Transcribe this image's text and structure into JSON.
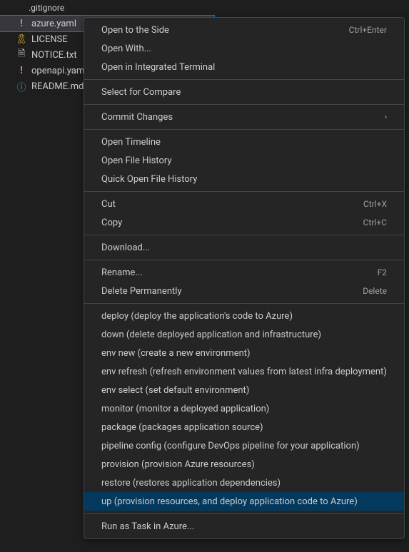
{
  "fileTree": {
    "items": [
      {
        "name": "azure.yaml",
        "icon": "yaml",
        "iconChar": "!",
        "selected": true
      },
      {
        "name": "LICENSE",
        "icon": "license",
        "iconChar": "🎗"
      },
      {
        "name": "NOTICE.txt",
        "icon": "txt",
        "iconChar": "🗎"
      },
      {
        "name": "openapi.yam",
        "icon": "yaml",
        "iconChar": "!"
      },
      {
        "name": "README.md",
        "icon": "info",
        "iconChar": "ⓘ"
      }
    ]
  },
  "contextMenu": {
    "groups": [
      [
        {
          "label": "Open to the Side",
          "shortcut": "Ctrl+Enter"
        },
        {
          "label": "Open With..."
        },
        {
          "label": "Open in Integrated Terminal"
        }
      ],
      [
        {
          "label": "Select for Compare"
        }
      ],
      [
        {
          "label": "Commit Changes",
          "submenu": true
        }
      ],
      [
        {
          "label": "Open Timeline"
        },
        {
          "label": "Open File History"
        },
        {
          "label": "Quick Open File History"
        }
      ],
      [
        {
          "label": "Cut",
          "shortcut": "Ctrl+X"
        },
        {
          "label": "Copy",
          "shortcut": "Ctrl+C"
        }
      ],
      [
        {
          "label": "Download..."
        }
      ],
      [
        {
          "label": "Rename...",
          "shortcut": "F2"
        },
        {
          "label": "Delete Permanently",
          "shortcut": "Delete"
        }
      ],
      [
        {
          "label": "deploy (deploy the application's code to Azure)"
        },
        {
          "label": "down (delete deployed application and infrastructure)"
        },
        {
          "label": "env new (create a new environment)"
        },
        {
          "label": "env refresh (refresh environment values from latest infra deployment)"
        },
        {
          "label": "env select (set default environment)"
        },
        {
          "label": "monitor (monitor a deployed application)"
        },
        {
          "label": "package (packages application source)"
        },
        {
          "label": "pipeline config (configure DevOps pipeline for your application)"
        },
        {
          "label": "provision (provision Azure resources)"
        },
        {
          "label": "restore (restores application dependencies)"
        },
        {
          "label": "up (provision resources, and deploy application code to Azure)",
          "highlighted": true
        }
      ],
      [
        {
          "label": "Run as Task in Azure..."
        }
      ]
    ]
  }
}
